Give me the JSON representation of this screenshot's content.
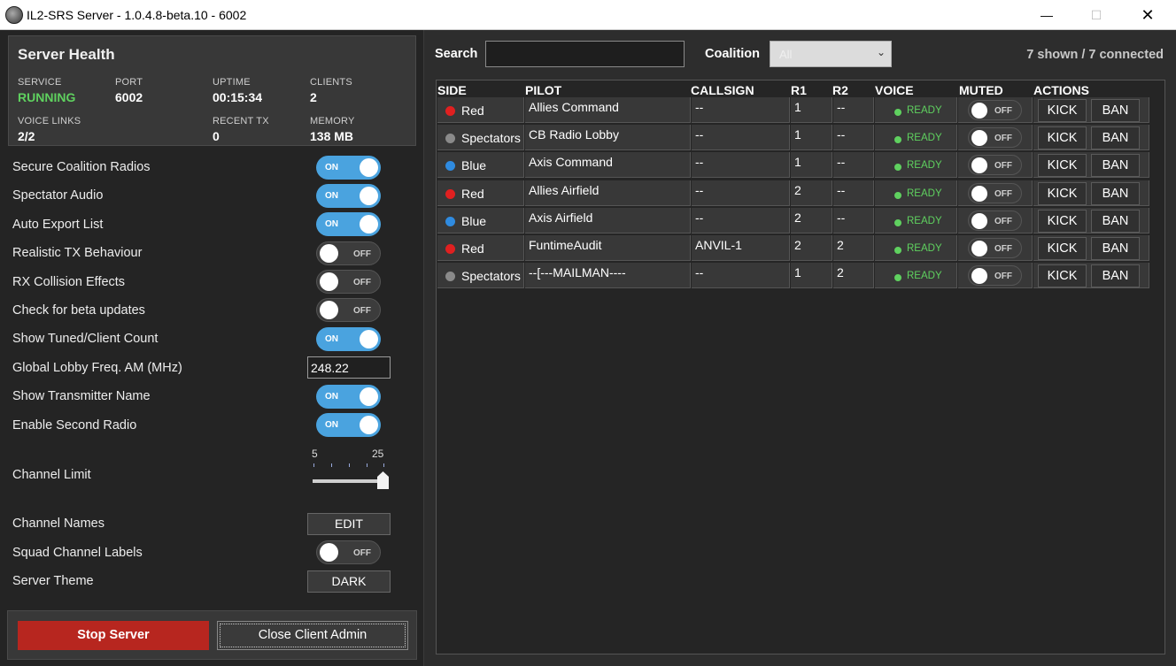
{
  "window": {
    "title": "IL2-SRS Server - 1.0.4.8-beta.10 - 6002",
    "minimize": "—",
    "maximize": "☐",
    "close": "✕"
  },
  "health": {
    "title": "Server Health",
    "service_label": "SERVICE",
    "service_value": "RUNNING",
    "port_label": "PORT",
    "port_value": "6002",
    "uptime_label": "UPTIME",
    "uptime_value": "00:15:34",
    "clients_label": "CLIENTS",
    "clients_value": "2",
    "voice_links_label": "VOICE LINKS",
    "voice_links_value": "2/2",
    "recent_tx_label": "RECENT TX",
    "recent_tx_value": "0",
    "memory_label": "MEMORY",
    "memory_value": "138 MB"
  },
  "toggle_text": {
    "on": "ON",
    "off": "OFF"
  },
  "settings": {
    "secure_coalition": "Secure Coalition Radios",
    "spectator_audio": "Spectator Audio",
    "auto_export": "Auto Export List",
    "realistic_tx": "Realistic TX Behaviour",
    "rx_collision": "RX Collision Effects",
    "beta_updates": "Check for beta updates",
    "tuned_count": "Show Tuned/Client Count",
    "lobby_freq": "Global Lobby Freq. AM (MHz)",
    "lobby_freq_value": "248.22",
    "transmitter_name": "Show Transmitter Name",
    "second_radio": "Enable Second Radio",
    "channel_limit": "Channel Limit",
    "channel_limit_min": "5",
    "channel_limit_max": "25",
    "channel_limit_value": 25,
    "channel_names": "Channel Names",
    "channel_names_button": "EDIT",
    "squad_labels": "Squad Channel Labels",
    "server_theme": "Server Theme",
    "server_theme_button": "DARK"
  },
  "actions": {
    "stop_server": "Stop Server",
    "close_admin": "Close Client Admin"
  },
  "toolbar": {
    "search_label": "Search",
    "search_value": "",
    "coalition_label": "Coalition",
    "coalition_value": "All",
    "shown_text": "7 shown / 7 connected"
  },
  "table": {
    "headers": {
      "side": "SIDE",
      "pilot": "PILOT",
      "callsign": "CALLSIGN",
      "r1": "R1",
      "r2": "R2",
      "voice": "VOICE",
      "muted": "MUTED",
      "actions": "ACTIONS"
    },
    "voice_text": "READY",
    "muted_text": "OFF",
    "kick": "KICK",
    "ban": "BAN",
    "side_colors": {
      "Red": "#e02020",
      "Blue": "#2f8be0",
      "Spectators": "#8a8a8a"
    },
    "rows": [
      {
        "side": "Red",
        "pilot": "Allies Command",
        "callsign": "--",
        "r1": "1",
        "r2": "--"
      },
      {
        "side": "Spectators",
        "pilot": "CB Radio Lobby",
        "callsign": "--",
        "r1": "1",
        "r2": "--"
      },
      {
        "side": "Blue",
        "pilot": "Axis Command",
        "callsign": "--",
        "r1": "1",
        "r2": "--"
      },
      {
        "side": "Red",
        "pilot": "Allies Airfield",
        "callsign": "--",
        "r1": "2",
        "r2": "--"
      },
      {
        "side": "Blue",
        "pilot": "Axis Airfield",
        "callsign": "--",
        "r1": "2",
        "r2": "--"
      },
      {
        "side": "Red",
        "pilot": "FuntimeAudit",
        "callsign": "ANVIL-1",
        "r1": "2",
        "r2": "2"
      },
      {
        "side": "Spectators",
        "pilot": "--[---MAILMAN----",
        "callsign": "--",
        "r1": "1",
        "r2": "2"
      }
    ]
  }
}
